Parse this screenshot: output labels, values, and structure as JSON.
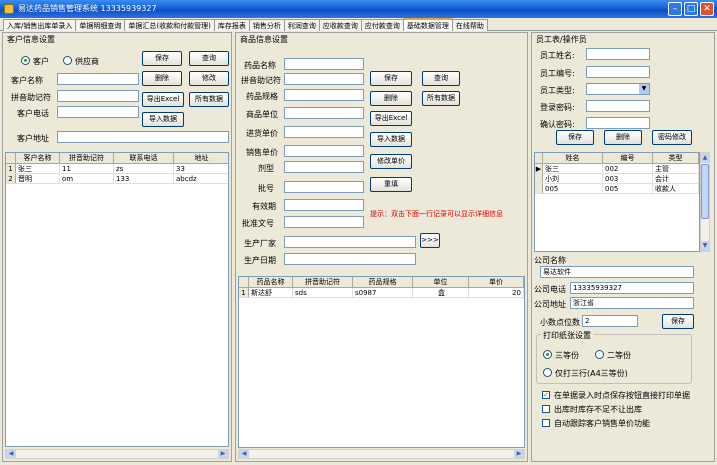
{
  "window": {
    "title": "易达药品销售管理系统 13335939327"
  },
  "tabs": [
    "入库/销售出库单录入",
    "单据明细查询",
    "单据汇总(收款和付款管理)",
    "库存报表",
    "销售分析",
    "利润查询",
    "应收款查询",
    "应付款查询",
    "基础数据管理",
    "在线帮助"
  ],
  "customer": {
    "group_title": "客户信息设置",
    "radio_customer": "客户",
    "radio_supplier": "供应商",
    "name_label": "客户名称",
    "pinyin_label": "拼音助记符",
    "phone_label": "客户电话",
    "address_label": "客户地址",
    "btn_save": "保存",
    "btn_query": "查询",
    "btn_delete": "删除",
    "btn_modify": "修改",
    "btn_export": "导出Excel",
    "btn_all": "所有数据",
    "btn_import": "导入数据",
    "columns": [
      "客户名称",
      "拼音助记符",
      "联系电话",
      "地址"
    ],
    "rows": [
      {
        "no": "1",
        "name": "张三",
        "pinyin": "11",
        "phone": "zs",
        "addr": "33"
      },
      {
        "no": "2",
        "name": "晋明",
        "pinyin": "om",
        "phone": "133",
        "addr": "abcdz"
      }
    ]
  },
  "product": {
    "group_title": "商品信息设置",
    "labels": [
      "药品名称",
      "拼音助记符",
      "药品规格",
      "商品单位",
      "进货单价",
      "销售单价",
      "剂型",
      "批号",
      "有效期",
      "批准文号",
      "生产厂家",
      "生产日期"
    ],
    "btn_save": "保存",
    "btn_query": "查询",
    "btn_delete": "删除",
    "btn_all": "所有数据",
    "btn_export": "导出Excel",
    "btn_import": "导入数据",
    "btn_modify_price": "修改单价",
    "btn_reset": "重填",
    "btn_more": ">>>",
    "hint": "提示：双击下面一行记录可以显示详细信息",
    "columns": [
      "药品名称",
      "拼音助记符",
      "药品规格",
      "单位",
      "单价"
    ],
    "rows": [
      {
        "no": "1",
        "name": "斯达舒",
        "pinyin": "sds",
        "spec": "s0987",
        "unit": "盒",
        "price": "20"
      }
    ]
  },
  "staff": {
    "group_title": "员工表/操作员",
    "name_label": "员工姓名:",
    "id_label": "员工编号:",
    "type_label": "员工类型:",
    "login_pwd_label": "登录密码:",
    "confirm_pwd_label": "确认密码:",
    "btn_save": "保存",
    "btn_delete": "删除",
    "btn_change_pwd": "密码修改",
    "columns": [
      "姓名",
      "编号",
      "类型"
    ],
    "rows": [
      {
        "name": "张三",
        "id": "002",
        "type": "主管"
      },
      {
        "name": "小刘",
        "id": "003",
        "type": "会计"
      },
      {
        "name": "005",
        "id": "005",
        "type": "收款人"
      }
    ]
  },
  "company": {
    "name_label": "公司名称",
    "name_value": "易达软件",
    "phone_label": "公司电话",
    "phone_value": "13335939327",
    "address_label": "公司地址",
    "address_value": "浙江省",
    "decimal_label": "小数点位数",
    "decimal_value": "2",
    "btn_save": "保存"
  },
  "print": {
    "group_title": "打印纸张设置",
    "opt_three": "三等份",
    "opt_two": "二等份",
    "opt_three_rows": "仅打三行(A4三等份)",
    "selected": "三等份"
  },
  "options": [
    {
      "label": "在单据录入时点保存按钮直接打印单据",
      "checked": true
    },
    {
      "label": "出库时库存不足不让出库",
      "checked": false
    },
    {
      "label": "自动跟踪客户销售单价功能",
      "checked": false
    }
  ]
}
